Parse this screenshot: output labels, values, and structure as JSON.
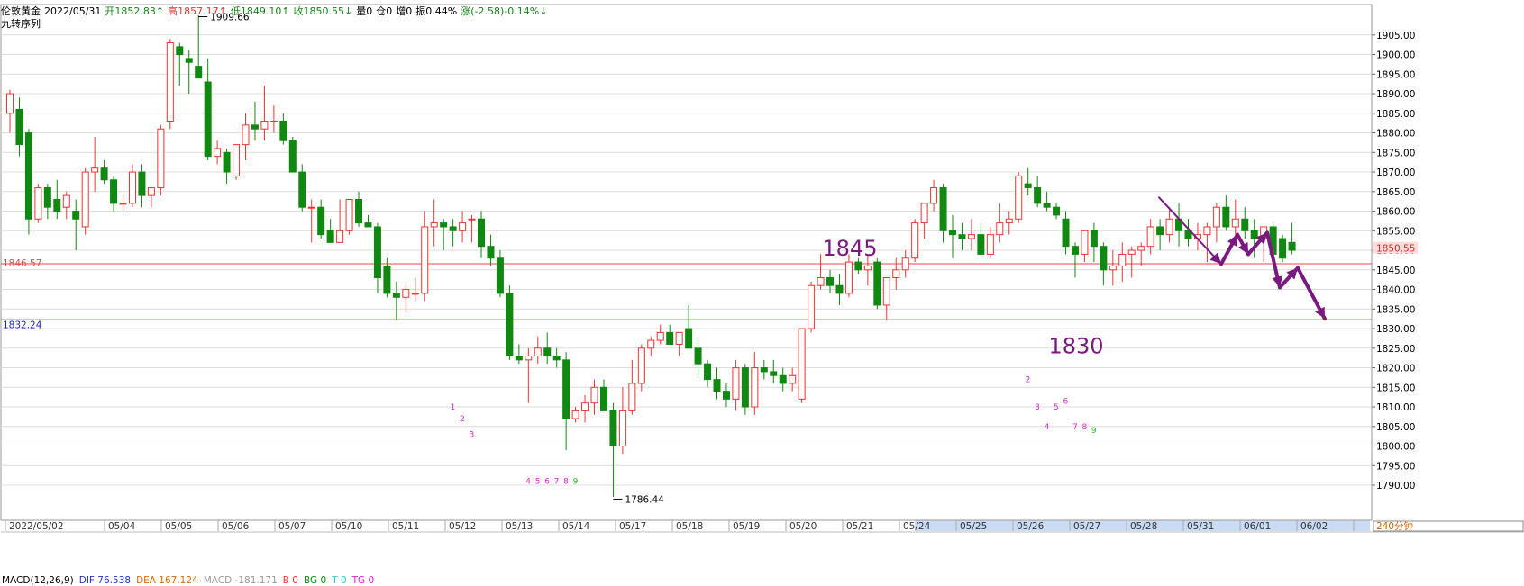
{
  "header": {
    "symbol": "伦敦黄金",
    "date": "2022/05/31",
    "open": "开1852.83↑",
    "high": "高1857.17↑",
    "low": "低1849.10↑",
    "close": "收1850.55↓",
    "volume": "量0",
    "openint": "仓0",
    "increase": "增0",
    "amplitude": "振0.44%",
    "change": "涨(-2.58)-0.14%↓"
  },
  "subtitle": "九转序列",
  "period_label": "240分钟",
  "indicator": {
    "macd_params": "MACD(12,26,9)",
    "dif": "DIF 76.538",
    "dea": "DEA 167.124",
    "macd": "MACD -181.171",
    "b": "B 0",
    "bg": "BG 0",
    "t": "T 0",
    "tg": "TG 0"
  },
  "colors": {
    "up": "#ee3333",
    "down": "#118811",
    "red_line": "#ee4444",
    "blue_line": "#2222cc",
    "arrow": "#7a1a80",
    "seq_magenta": "#dd22dd",
    "seq_green": "#22bb22",
    "price_tag_bg": "#ffdddd"
  },
  "chart_data": {
    "type": "candlestick",
    "y_range": [
      1786,
      1912
    ],
    "y_ticks": [
      "1790.00",
      "1795.00",
      "1800.00",
      "1805.00",
      "1810.00",
      "1815.00",
      "1820.00",
      "1825.00",
      "1830.00",
      "1835.00",
      "1840.00",
      "1845.00",
      "1850.00",
      "1855.00",
      "1860.00",
      "1865.00",
      "1870.00",
      "1875.00",
      "1880.00",
      "1885.00",
      "1890.00",
      "1895.00",
      "1900.00",
      "1905.00"
    ],
    "x_labels": [
      "2022/05/02",
      "05/04",
      "05/05",
      "05/06",
      "05/07",
      "05/10",
      "05/11",
      "05/12",
      "05/13",
      "05/14",
      "05/17",
      "05/18",
      "05/19",
      "05/20",
      "05/21",
      "05/24",
      "05/25",
      "05/26",
      "05/27",
      "05/28",
      "05/31",
      "06/01",
      "06/02"
    ],
    "candles": [
      [
        1885,
        1891,
        1880,
        1890
      ],
      [
        1886,
        1889,
        1874,
        1877
      ],
      [
        1880,
        1881,
        1854,
        1858
      ],
      [
        1858,
        1867,
        1857,
        1866
      ],
      [
        1866,
        1867,
        1858,
        1861
      ],
      [
        1863,
        1868,
        1858,
        1860
      ],
      [
        1861,
        1865,
        1858,
        1864
      ],
      [
        1860,
        1863,
        1850,
        1858
      ],
      [
        1856,
        1871,
        1854,
        1870
      ],
      [
        1870,
        1879,
        1865,
        1871
      ],
      [
        1871,
        1873,
        1867,
        1868
      ],
      [
        1868,
        1869,
        1860,
        1862
      ],
      [
        1862,
        1864,
        1860,
        1862
      ],
      [
        1862,
        1872,
        1861,
        1870
      ],
      [
        1870,
        1872,
        1861,
        1864
      ],
      [
        1864,
        1866,
        1861,
        1866
      ],
      [
        1866,
        1882,
        1864,
        1881
      ],
      [
        1883,
        1904,
        1881,
        1903
      ],
      [
        1902,
        1903,
        1892,
        1900
      ],
      [
        1899,
        1901,
        1890,
        1898
      ],
      [
        1897,
        1910,
        1895,
        1894
      ],
      [
        1893,
        1899,
        1873,
        1874
      ],
      [
        1874,
        1878,
        1872,
        1876
      ],
      [
        1875,
        1876,
        1867,
        1870
      ],
      [
        1869,
        1877,
        1868,
        1877
      ],
      [
        1877,
        1885,
        1873,
        1882
      ],
      [
        1882,
        1888,
        1878,
        1881
      ],
      [
        1881,
        1892,
        1878,
        1883
      ],
      [
        1883,
        1887,
        1880,
        1883
      ],
      [
        1883,
        1885,
        1877,
        1878
      ],
      [
        1878,
        1879,
        1870,
        1870
      ],
      [
        1870,
        1872,
        1860,
        1861
      ],
      [
        1861,
        1863,
        1852,
        1861
      ],
      [
        1861,
        1863,
        1853,
        1854
      ],
      [
        1855,
        1858,
        1852,
        1852
      ],
      [
        1852,
        1863,
        1852,
        1855
      ],
      [
        1855,
        1863,
        1854,
        1863
      ],
      [
        1863,
        1865,
        1856,
        1857
      ],
      [
        1857,
        1859,
        1856,
        1856
      ],
      [
        1856,
        1857,
        1839,
        1843
      ],
      [
        1846,
        1848,
        1838,
        1839
      ],
      [
        1839,
        1842,
        1832,
        1838
      ],
      [
        1838,
        1841,
        1834,
        1840
      ],
      [
        1839,
        1843,
        1837,
        1839
      ],
      [
        1839,
        1860,
        1837,
        1856
      ],
      [
        1856,
        1863,
        1851,
        1857
      ],
      [
        1857,
        1858,
        1850,
        1856
      ],
      [
        1856,
        1858,
        1851,
        1855
      ],
      [
        1855,
        1860,
        1852,
        1857
      ],
      [
        1858,
        1859,
        1852,
        1858
      ],
      [
        1858,
        1860,
        1848,
        1851
      ],
      [
        1851,
        1854,
        1846,
        1848
      ],
      [
        1848,
        1850,
        1838,
        1839
      ],
      [
        1839,
        1841,
        1822,
        1823
      ],
      [
        1823,
        1826,
        1821,
        1822
      ],
      [
        1822,
        1825,
        1811,
        1823
      ],
      [
        1823,
        1828,
        1821,
        1825
      ],
      [
        1825,
        1829,
        1821,
        1823
      ],
      [
        1823,
        1825,
        1820,
        1822
      ],
      [
        1822,
        1824,
        1799,
        1807
      ],
      [
        1807,
        1810,
        1806,
        1809
      ],
      [
        1809,
        1813,
        1806,
        1811
      ],
      [
        1811,
        1817,
        1808,
        1815
      ],
      [
        1815,
        1817,
        1809,
        1809
      ],
      [
        1809,
        1811,
        1787,
        1800
      ],
      [
        1800,
        1815,
        1798,
        1809
      ],
      [
        1809,
        1822,
        1808,
        1816
      ],
      [
        1816,
        1826,
        1814,
        1825
      ],
      [
        1825,
        1828,
        1823,
        1827
      ],
      [
        1827,
        1831,
        1826,
        1829
      ],
      [
        1829,
        1831,
        1826,
        1826
      ],
      [
        1826,
        1829,
        1823,
        1829
      ],
      [
        1830,
        1836,
        1825,
        1825
      ],
      [
        1825,
        1827,
        1818,
        1821
      ],
      [
        1821,
        1822,
        1815,
        1817
      ],
      [
        1817,
        1820,
        1812,
        1814
      ],
      [
        1814,
        1816,
        1810,
        1812
      ],
      [
        1812,
        1822,
        1809,
        1820
      ],
      [
        1820,
        1821,
        1808,
        1810
      ],
      [
        1810,
        1824,
        1808,
        1820
      ],
      [
        1820,
        1822,
        1817,
        1819
      ],
      [
        1819,
        1822,
        1816,
        1818
      ],
      [
        1818,
        1820,
        1814,
        1816
      ],
      [
        1816,
        1820,
        1814,
        1818
      ],
      [
        1812,
        1830,
        1811,
        1830
      ],
      [
        1830,
        1842,
        1829,
        1841
      ],
      [
        1841,
        1849,
        1840,
        1843
      ],
      [
        1843,
        1845,
        1839,
        1841
      ],
      [
        1841,
        1844,
        1836,
        1839
      ],
      [
        1839,
        1849,
        1838,
        1847
      ],
      [
        1847,
        1848,
        1844,
        1845
      ],
      [
        1845,
        1849,
        1841,
        1846
      ],
      [
        1847,
        1848,
        1835,
        1836
      ],
      [
        1836,
        1843,
        1832,
        1843
      ],
      [
        1843,
        1848,
        1840,
        1845
      ],
      [
        1845,
        1850,
        1843,
        1848
      ],
      [
        1848,
        1858,
        1847,
        1857
      ],
      [
        1857,
        1860,
        1853,
        1862
      ],
      [
        1862,
        1868,
        1860,
        1866
      ],
      [
        1866,
        1867,
        1852,
        1855
      ],
      [
        1855,
        1859,
        1848,
        1854
      ],
      [
        1854,
        1857,
        1850,
        1853
      ],
      [
        1853,
        1858,
        1850,
        1854
      ],
      [
        1854,
        1857,
        1849,
        1849
      ],
      [
        1849,
        1856,
        1848,
        1854
      ],
      [
        1854,
        1862,
        1852,
        1857
      ],
      [
        1857,
        1860,
        1854,
        1858
      ],
      [
        1858,
        1870,
        1857,
        1869
      ],
      [
        1867,
        1871,
        1864,
        1866
      ],
      [
        1866,
        1869,
        1861,
        1862
      ],
      [
        1862,
        1865,
        1860,
        1861
      ],
      [
        1861,
        1862,
        1858,
        1859
      ],
      [
        1858,
        1860,
        1849,
        1851
      ],
      [
        1851,
        1852,
        1843,
        1849
      ],
      [
        1849,
        1855,
        1847,
        1855
      ],
      [
        1855,
        1857,
        1847,
        1851
      ],
      [
        1851,
        1852,
        1841,
        1845
      ],
      [
        1845,
        1850,
        1841,
        1846
      ],
      [
        1846,
        1852,
        1842,
        1849
      ],
      [
        1849,
        1851,
        1843,
        1850
      ],
      [
        1850,
        1852,
        1846,
        1851
      ],
      [
        1851,
        1858,
        1849,
        1856
      ],
      [
        1856,
        1858,
        1850,
        1854
      ],
      [
        1854,
        1861,
        1852,
        1858
      ],
      [
        1858,
        1862,
        1851,
        1855
      ],
      [
        1855,
        1858,
        1851,
        1853
      ],
      [
        1853,
        1857,
        1850,
        1854
      ],
      [
        1854,
        1857,
        1847,
        1856
      ],
      [
        1856,
        1862,
        1852,
        1861
      ],
      [
        1861,
        1864,
        1855,
        1856
      ],
      [
        1856,
        1863,
        1854,
        1858
      ],
      [
        1858,
        1861,
        1853,
        1855
      ],
      [
        1855,
        1858,
        1848,
        1853
      ],
      [
        1853,
        1856,
        1847,
        1856
      ],
      [
        1856,
        1857,
        1846,
        1849
      ],
      [
        1853,
        1854,
        1847,
        1848
      ],
      [
        1852,
        1857,
        1849,
        1850
      ]
    ],
    "horizontal_lines": [
      {
        "price": 1846.57,
        "label": "1846.57",
        "color": "red"
      },
      {
        "price": 1832.24,
        "label": "1832.24",
        "color": "blue"
      }
    ],
    "last_price": "1850.55",
    "annotations": [
      {
        "text": "1909.66",
        "candle": 20,
        "price": 1909.66,
        "kind": "high"
      },
      {
        "text": "1786.44",
        "candle": 64,
        "price": 1786.44,
        "kind": "low"
      },
      {
        "text": "1845",
        "x_index": 90,
        "price": 1850.5,
        "kind": "big"
      },
      {
        "text": "1830",
        "x_index": 114,
        "price": 1825.5,
        "kind": "big"
      }
    ],
    "sequence_markers": [
      {
        "text": "1",
        "candle": 47,
        "price": 1810,
        "color": "magenta"
      },
      {
        "text": "2",
        "candle": 48,
        "price": 1807,
        "color": "magenta"
      },
      {
        "text": "3",
        "candle": 49,
        "price": 1803,
        "color": "magenta"
      },
      {
        "text": "4",
        "candle": 55,
        "price": 1791,
        "color": "magenta"
      },
      {
        "text": "5",
        "candle": 56,
        "price": 1791,
        "color": "magenta"
      },
      {
        "text": "6",
        "candle": 57,
        "price": 1791,
        "color": "magenta"
      },
      {
        "text": "7",
        "candle": 58,
        "price": 1791,
        "color": "magenta"
      },
      {
        "text": "8",
        "candle": 59,
        "price": 1791,
        "color": "magenta"
      },
      {
        "text": "9",
        "candle": 60,
        "price": 1791,
        "color": "green"
      },
      {
        "text": "2",
        "candle": 108,
        "price": 1817,
        "color": "magenta"
      },
      {
        "text": "3",
        "candle": 109,
        "price": 1810,
        "color": "magenta"
      },
      {
        "text": "4",
        "candle": 110,
        "price": 1805,
        "color": "magenta"
      },
      {
        "text": "5",
        "candle": 111,
        "price": 1810,
        "color": "magenta"
      },
      {
        "text": "6",
        "candle": 112,
        "price": 1811.5,
        "color": "magenta"
      },
      {
        "text": "7",
        "candle": 113,
        "price": 1805,
        "color": "magenta"
      },
      {
        "text": "8",
        "candle": 114,
        "price": 1805,
        "color": "magenta"
      },
      {
        "text": "9",
        "candle": 115,
        "price": 1804,
        "color": "green"
      }
    ],
    "projection_path": [
      [
        1286,
        1863.5
      ],
      [
        1355,
        1846.5
      ],
      [
        1373,
        1854
      ],
      [
        1385,
        1849
      ],
      [
        1406,
        1854.5
      ],
      [
        1420,
        1840.5
      ],
      [
        1440,
        1845.5
      ],
      [
        1470,
        1832.5
      ]
    ]
  }
}
